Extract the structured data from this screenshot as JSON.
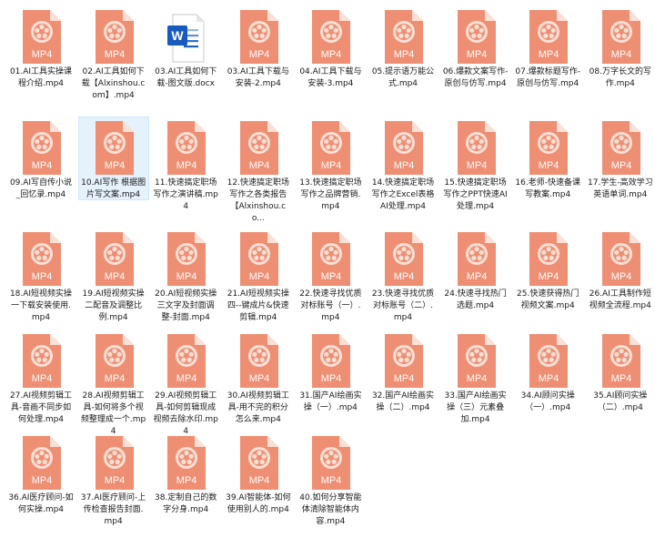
{
  "colors": {
    "mp4_icon_fill": "#ee8f74",
    "mp4_icon_light": "#fbe0d6",
    "mp4_text": "#ffffff",
    "word_blue": "#185abd",
    "selected_bg": "#e5f1fb",
    "selected_border": "#cce8ff"
  },
  "icon_text": "MP4",
  "files": [
    {
      "name": "01.AI工具实操课程介绍.mp4",
      "type": "mp4-icon",
      "selected": false
    },
    {
      "name": "02.AI工具如何下载【Alxinshou.com】.mp4",
      "type": "mp4-icon",
      "selected": false
    },
    {
      "name": "03.AI工具如何下载-图文版.docx",
      "type": "word-icon",
      "selected": false
    },
    {
      "name": "03.AI工具下载与安装-2.mp4",
      "type": "mp4-icon",
      "selected": false
    },
    {
      "name": "04.AI工具下载与安装-3.mp4",
      "type": "mp4-icon",
      "selected": false
    },
    {
      "name": "05.提示语万能公式.mp4",
      "type": "mp4-icon",
      "selected": false
    },
    {
      "name": "06.爆款文案写作-原创与仿写.mp4",
      "type": "mp4-icon",
      "selected": false
    },
    {
      "name": "07.爆款标题写作-原创与仿写.mp4",
      "type": "mp4-icon",
      "selected": false
    },
    {
      "name": "08.万字长文的写作.mp4",
      "type": "mp4-icon",
      "selected": false
    },
    {
      "name": "09.AI写自传小说_回忆录.mp4",
      "type": "mp4-icon",
      "selected": false
    },
    {
      "name": "10.AI写作 根据图片写文案.mp4",
      "type": "mp4-icon",
      "selected": true
    },
    {
      "name": "11.快速搞定职场写作之演讲稿.mp4",
      "type": "mp4-icon",
      "selected": false
    },
    {
      "name": "12.快速搞定职场写作之各类报告【Alxinshou.co...",
      "type": "mp4-icon",
      "selected": false
    },
    {
      "name": "13.快速搞定职场写作之品牌营销.mp4",
      "type": "mp4-icon",
      "selected": false
    },
    {
      "name": "14.快速搞定职场写作之Excel表格AI处理.mp4",
      "type": "mp4-icon",
      "selected": false
    },
    {
      "name": "15.快速搞定职场写作之PPT快速AI处理.mp4",
      "type": "mp4-icon",
      "selected": false
    },
    {
      "name": "16.老师-快速备课写教案.mp4",
      "type": "mp4-icon",
      "selected": false
    },
    {
      "name": "17.学生-高效学习英语单词.mp4",
      "type": "mp4-icon",
      "selected": false
    },
    {
      "name": "18.AI短视频实操一下载安装使用.mp4",
      "type": "mp4-icon",
      "selected": false
    },
    {
      "name": "19.AI短视频实操二配音及调整比例.mp4",
      "type": "mp4-icon",
      "selected": false
    },
    {
      "name": "20.AI短视频实操三文字及封面调整-封面.mp4",
      "type": "mp4-icon",
      "selected": false
    },
    {
      "name": "21.AI短视频实操四--键成片&快速剪辑.mp4",
      "type": "mp4-icon",
      "selected": false
    },
    {
      "name": "22.快速寻找优质对标账号（一）.mp4",
      "type": "mp4-icon",
      "selected": false
    },
    {
      "name": "23.快速寻找优质对标账号（二）.mp4",
      "type": "mp4-icon",
      "selected": false
    },
    {
      "name": "24.快速寻找热门选题.mp4",
      "type": "mp4-icon",
      "selected": false
    },
    {
      "name": "25.快速获得热门视频文案.mp4",
      "type": "mp4-icon",
      "selected": false
    },
    {
      "name": "26.AI工具制作短视频全流程.mp4",
      "type": "mp4-icon",
      "selected": false
    },
    {
      "name": "27.AI视频剪辑工具-音画不同步如何处理.mp4",
      "type": "mp4-icon",
      "selected": false
    },
    {
      "name": "28.AI视频剪辑工具-如何将多个视频整理成一个.mp4",
      "type": "mp4-icon",
      "selected": false
    },
    {
      "name": "29.AI视频剪辑工具-如何剪辑现成视频去除水印.mp4",
      "type": "mp4-icon",
      "selected": false
    },
    {
      "name": "30.AI视频剪辑工具-用不完的积分怎么来.mp4",
      "type": "mp4-icon",
      "selected": false
    },
    {
      "name": "31.国产AI绘画实操（一）.mp4",
      "type": "mp4-icon",
      "selected": false
    },
    {
      "name": "32.国产AI绘画实操（二）.mp4",
      "type": "mp4-icon",
      "selected": false
    },
    {
      "name": "33.国产AI绘画实操（三）元素叠加.mp4",
      "type": "mp4-icon",
      "selected": false
    },
    {
      "name": "34.AI顾问实操（一）.mp4",
      "type": "mp4-icon",
      "selected": false
    },
    {
      "name": "35.AI顾问实操（二）.mp4",
      "type": "mp4-icon",
      "selected": false
    },
    {
      "name": "36.AI医疗顾问-如何实操.mp4",
      "type": "mp4-icon",
      "selected": false
    },
    {
      "name": "37.AI医疗顾问-上传检查报告封面.mp4",
      "type": "mp4-icon",
      "selected": false
    },
    {
      "name": "38.定制自己的数字分身.mp4",
      "type": "mp4-icon",
      "selected": false
    },
    {
      "name": "39.AI智能体-如何使用别人的.mp4",
      "type": "mp4-icon",
      "selected": false
    },
    {
      "name": "40.如何分享智能体清除智能体内容.mp4",
      "type": "mp4-icon",
      "selected": false
    }
  ]
}
